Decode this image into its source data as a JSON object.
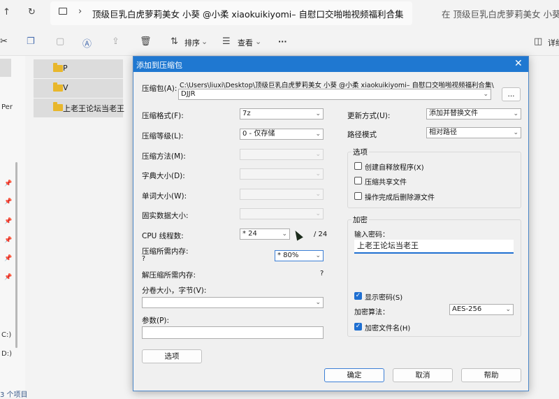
{
  "explorer": {
    "up_icon": "↑",
    "refresh_icon": "↻",
    "breadcrumb": "顶级巨乳白虎萝莉美女 小葵 @小柔 xiaokuikiyomi– 自慰口交啪啪视频福利合集",
    "search_placeholder": "在 顶级巨乳白虎萝莉美女 小葵 @...",
    "toolbar": {
      "sort": "排序",
      "view": "查看",
      "more": "···",
      "details": "详细"
    },
    "nav_items": {
      "per": "Per",
      "drive_c": "C:)",
      "drive_d": "D:)"
    },
    "files": [
      "P",
      "V",
      "上老王论坛当老王"
    ],
    "status": "3 个项目"
  },
  "dialog": {
    "title": "添加到压缩包",
    "archive_label": "压缩包(A):",
    "archive_path": "C:\\Users\\liuxi\\Desktop\\顶级巨乳白虎萝莉美女 小葵 @小柔 xiaokuikiyomi– 自慰口交啪啪视频福利合集\\",
    "archive_name": "DJJR",
    "browse_label": "...",
    "format_label": "压缩格式(F):",
    "format_value": "7z",
    "level_label": "压缩等级(L):",
    "level_value": "0 - 仅存储",
    "method_label": "压缩方法(M):",
    "dict_label": "字典大小(D):",
    "word_label": "单词大小(W):",
    "solid_label": "固实数据大小:",
    "threads_label": "CPU 线程数:",
    "threads_value": "* 24",
    "threads_total": "/ 24",
    "mem_label": "压缩所需内存:",
    "mem_q": "?",
    "mem_value": "* 80%",
    "decomp_label": "解压缩所需内存:",
    "decomp_value": "?",
    "volume_label": "分卷大小，字节(V):",
    "params_label": "参数(P):",
    "options_button": "选项",
    "update_label": "更新方式(U):",
    "update_value": "添加并替换文件",
    "path_label": "路径模式",
    "path_value": "相对路径",
    "options_group": "选项",
    "opt_sfx": "创建自释放程序(X)",
    "opt_shared": "压缩共享文件",
    "opt_delete": "操作完成后删除源文件",
    "enc_group": "加密",
    "pw_label": "输入密码：",
    "pw_value": "上老王论坛当老王",
    "show_pw": "显示密码(S)",
    "enc_method_label": "加密算法：",
    "enc_method_value": "AES-256",
    "enc_names": "加密文件名(H)",
    "ok": "确定",
    "cancel": "取消",
    "help": "帮助"
  }
}
